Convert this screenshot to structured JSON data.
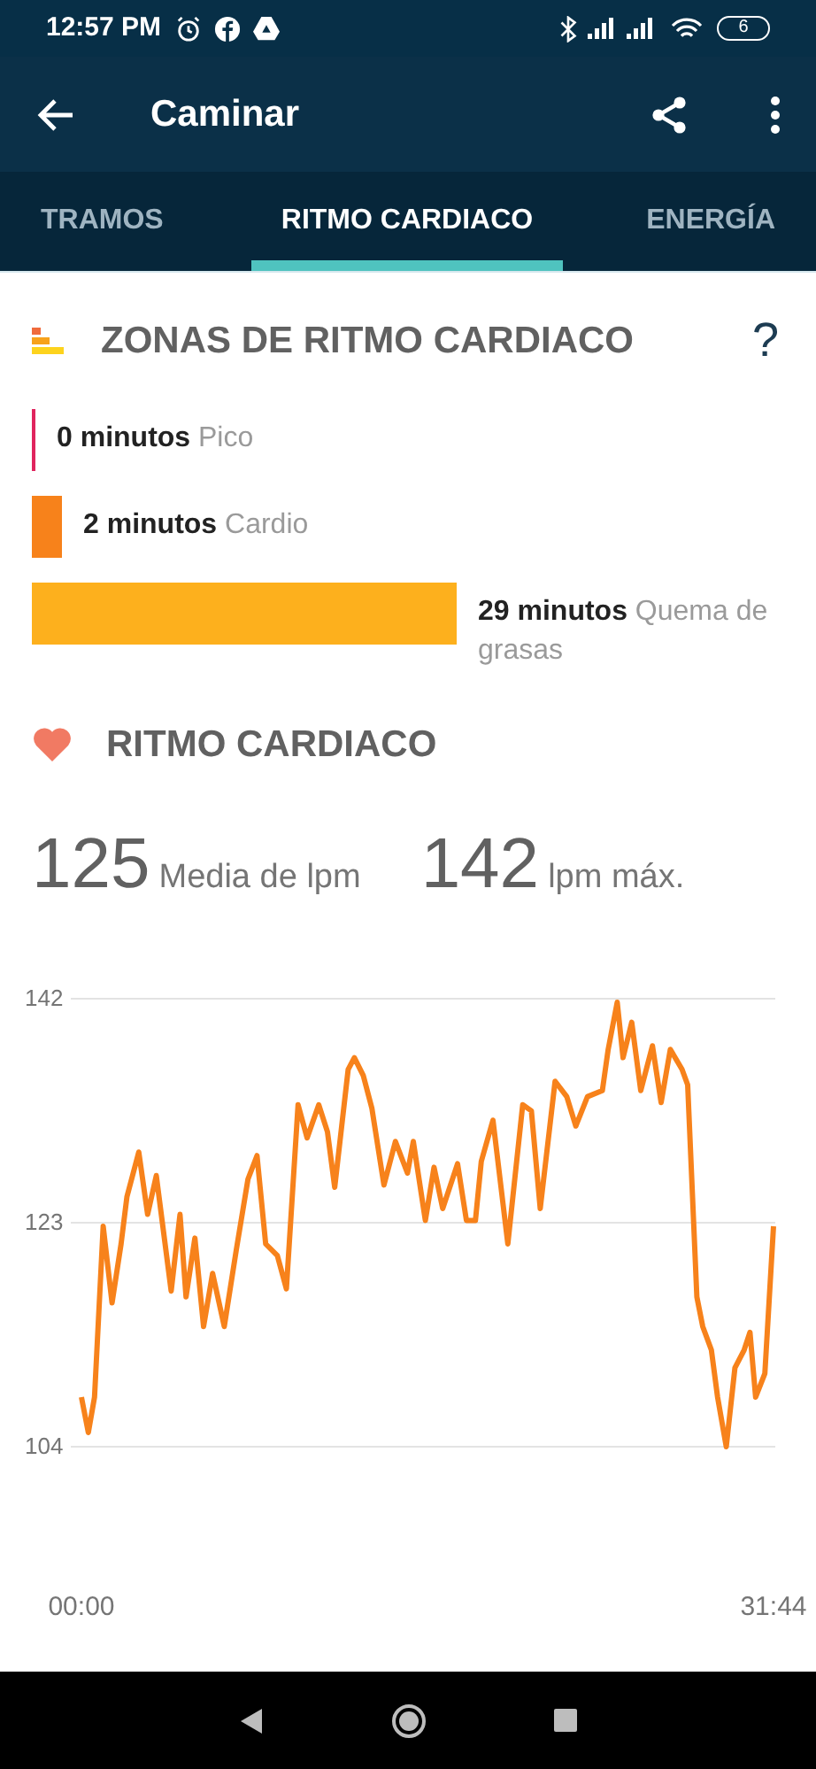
{
  "status_bar": {
    "time": "12:57 PM",
    "battery": "6"
  },
  "toolbar": {
    "title": "Caminar"
  },
  "tabs": [
    {
      "label": "TRAMOS",
      "selected": false
    },
    {
      "label": "RITMO CARDIACO",
      "selected": true
    },
    {
      "label": "ENERGÍA",
      "selected": false
    }
  ],
  "zones": {
    "title": "ZONAS DE RITMO CARDIACO",
    "help": "?",
    "items": [
      {
        "minutes": "0 minutos",
        "label": "Pico",
        "color": "#e0245e"
      },
      {
        "minutes": "2 minutos",
        "label": "Cardio",
        "color": "#f7821b"
      },
      {
        "minutes": "29 minutos",
        "label": "Quema de grasas",
        "color": "#fdb01d"
      }
    ]
  },
  "heart_rate": {
    "title": "RITMO CARDIACO",
    "stats": [
      {
        "bpm": "125",
        "caption": "Media de lpm"
      },
      {
        "bpm": "142",
        "caption": "lpm máx."
      }
    ],
    "chart_data": {
      "type": "line",
      "ylim": [
        104,
        142
      ],
      "yticks": [
        {
          "value": 104,
          "label": "104"
        },
        {
          "value": 123,
          "label": "123"
        },
        {
          "value": 142,
          "label": "142"
        }
      ],
      "xticks": [
        {
          "value": 0,
          "label": "00:00"
        },
        {
          "value": 1904,
          "label": "31:44"
        }
      ],
      "xlim": [
        0,
        1904
      ],
      "x": [
        0,
        19,
        36,
        60,
        84,
        109,
        125,
        158,
        182,
        206,
        247,
        271,
        288,
        312,
        336,
        361,
        393,
        426,
        458,
        483,
        507,
        539,
        564,
        596,
        621,
        653,
        677,
        697,
        734,
        751,
        775,
        799,
        832,
        864,
        897,
        913,
        946,
        970,
        994,
        1035,
        1059,
        1084,
        1100,
        1132,
        1173,
        1214,
        1238,
        1262,
        1303,
        1335,
        1360,
        1392,
        1433,
        1449,
        1474,
        1490,
        1514,
        1539,
        1571,
        1595,
        1620,
        1652,
        1668,
        1693,
        1709,
        1733,
        1750,
        1774,
        1798,
        1823,
        1839,
        1855,
        1880,
        1904
      ],
      "series": [
        {
          "color": "#f7821b",
          "values": [
            108.2,
            105.2,
            108.2,
            122.7,
            116.2,
            121.2,
            125.2,
            129,
            123.7,
            127,
            117.2,
            123.7,
            116.7,
            121.7,
            114.2,
            118.7,
            114.2,
            120.7,
            126.7,
            128.7,
            121.2,
            120.2,
            117.4,
            133,
            130.2,
            133,
            130.7,
            126,
            136,
            137,
            135.5,
            132.7,
            126.2,
            129.9,
            127.2,
            129.9,
            123.2,
            127.7,
            124.2,
            128,
            123.2,
            123.2,
            128.2,
            131.7,
            121.2,
            133,
            132.5,
            124.2,
            135,
            133.7,
            131.2,
            133.7,
            134.2,
            137.7,
            141.7,
            137,
            140,
            134.2,
            138,
            133.2,
            137.7,
            136,
            134.7,
            116.7,
            114.2,
            112.2,
            108.2,
            104,
            110.7,
            112.2,
            113.7,
            108.2,
            110.2,
            122.7
          ]
        }
      ]
    }
  }
}
